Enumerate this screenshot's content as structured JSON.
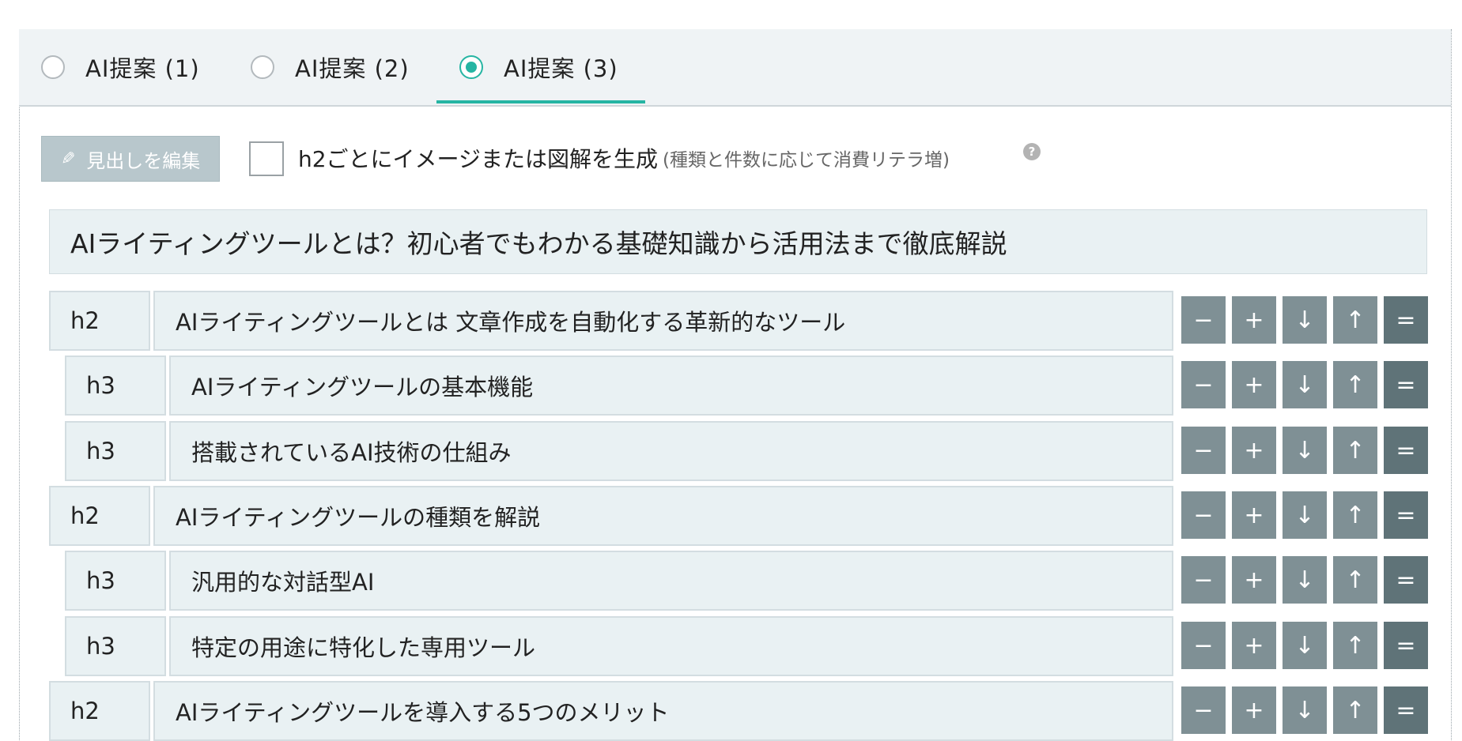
{
  "tabs": [
    {
      "label": "AI提案 (1)",
      "selected": false
    },
    {
      "label": "AI提案 (2)",
      "selected": false
    },
    {
      "label": "AI提案 (3)",
      "selected": true
    }
  ],
  "toolbar": {
    "edit_label": "見出しを編集",
    "image_option_label": "h2ごとにイメージまたは図解を生成",
    "image_option_note": "(種類と件数に応じて消費リテラ増)",
    "image_option_checked": false,
    "help_label": "?"
  },
  "title": "AIライティングツールとは？初心者でもわかる基礎知識から活用法まで徹底解説",
  "controls": {
    "remove": "−",
    "add": "+",
    "down": "↓",
    "up": "↑",
    "handle": "="
  },
  "headings": [
    {
      "level": "h2",
      "text": "AIライティングツールとは 文章作成を自動化する革新的なツール"
    },
    {
      "level": "h3",
      "text": "AIライティングツールの基本機能"
    },
    {
      "level": "h3",
      "text": "搭載されているAI技術の仕組み"
    },
    {
      "level": "h2",
      "text": "AIライティングツールの種類を解説"
    },
    {
      "level": "h3",
      "text": "汎用的な対話型AI"
    },
    {
      "level": "h3",
      "text": "特定の用途に特化した専用ツール"
    },
    {
      "level": "h2",
      "text": "AIライティングツールを導入する5つのメリット"
    }
  ],
  "colors": {
    "accent": "#26b5a3",
    "control_button": "#7f9095",
    "control_handle": "#5f7378",
    "row_background": "#e9f1f3"
  }
}
